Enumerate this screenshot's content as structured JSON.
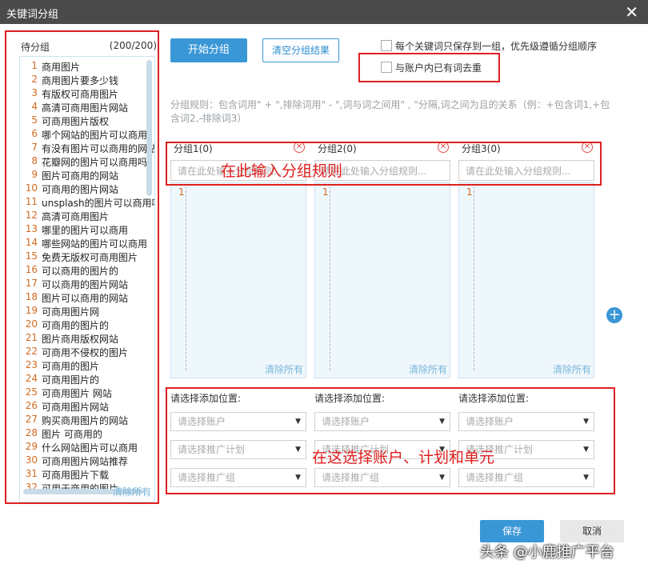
{
  "window": {
    "title": "关键词分组",
    "close": "✕"
  },
  "left": {
    "label": "待分组",
    "count": "(200/200)",
    "clear": "清除所有",
    "items": [
      {
        "n": "1",
        "t": "商用图片"
      },
      {
        "n": "2",
        "t": "商用图片要多少钱"
      },
      {
        "n": "3",
        "t": "有版权可商用图片"
      },
      {
        "n": "4",
        "t": "高清可商用图片网站"
      },
      {
        "n": "5",
        "t": "可商用图片版权"
      },
      {
        "n": "6",
        "t": "哪个网站的图片可以商用"
      },
      {
        "n": "7",
        "t": "有没有图片可以商用的网站"
      },
      {
        "n": "8",
        "t": "花瓣网的图片可以商用吗"
      },
      {
        "n": "9",
        "t": "图片可商用的网站"
      },
      {
        "n": "10",
        "t": "可商用的图片网站"
      },
      {
        "n": "11",
        "t": "unsplash的图片可以商用吗"
      },
      {
        "n": "12",
        "t": "高清可商用图片"
      },
      {
        "n": "13",
        "t": "哪里的图片可以商用"
      },
      {
        "n": "14",
        "t": "哪些网站的图片可以商用"
      },
      {
        "n": "15",
        "t": "免费无版权可商用图片"
      },
      {
        "n": "16",
        "t": "可以商用的图片的"
      },
      {
        "n": "17",
        "t": "可以商用的图片网站"
      },
      {
        "n": "18",
        "t": "图片可以商用的网站"
      },
      {
        "n": "19",
        "t": "可商用图片网"
      },
      {
        "n": "20",
        "t": "可商用的图片的"
      },
      {
        "n": "21",
        "t": "图片商用版权网站"
      },
      {
        "n": "22",
        "t": "可商用不侵权的图片"
      },
      {
        "n": "23",
        "t": "可商用的图片"
      },
      {
        "n": "24",
        "t": "可商用图片的"
      },
      {
        "n": "25",
        "t": "可商用图片 网站"
      },
      {
        "n": "26",
        "t": "可商用图片网站"
      },
      {
        "n": "27",
        "t": "购买商用图片的网站"
      },
      {
        "n": "28",
        "t": "图片 可商用的"
      },
      {
        "n": "29",
        "t": "什么网站图片可以商用"
      },
      {
        "n": "30",
        "t": "可商用图片网站推荐"
      },
      {
        "n": "31",
        "t": "可商用图片下载"
      },
      {
        "n": "32",
        "t": "可用于商用的图片"
      }
    ]
  },
  "toolbar": {
    "start": "开始分组",
    "clear_result": "清空分组结果",
    "opt1": "每个关键词只保存到一组，优先级遵循分组顺序",
    "opt2": "与账户内已有词去重"
  },
  "rule_hint": "分组规则：包含词用\" + \",排除词用\" - \",词与词之间用\" , \"分隔,词之间为且的关系（例：+包含词1,+包含词2,-排除词3）",
  "groups": [
    {
      "name": "分组1(0)",
      "placeholder": "请在此处输入分组规则...",
      "line": "1",
      "clear": "清除所有"
    },
    {
      "name": "分组2(0)",
      "placeholder": "请在此处输入分组规则...",
      "line": "1",
      "clear": "清除所有"
    },
    {
      "name": "分组3(0)",
      "placeholder": "请在此处输入分组规则...",
      "line": "1",
      "clear": "清除所有"
    }
  ],
  "add_icon": "+",
  "selectors": {
    "label": "请选择添加位置:",
    "account": "请选择账户",
    "plan": "请选择推广计划",
    "unit": "请选择推广组"
  },
  "annotations": {
    "rule": "在此输入分组规则",
    "select": "在这选择账户、计划和单元"
  },
  "footer": {
    "save": "保存",
    "cancel": "取消"
  },
  "watermark": "头条 @小鹿推广平台",
  "colors": {
    "primary": "#3a97d6",
    "annotation": "#e02020",
    "number": "#d06a20"
  }
}
